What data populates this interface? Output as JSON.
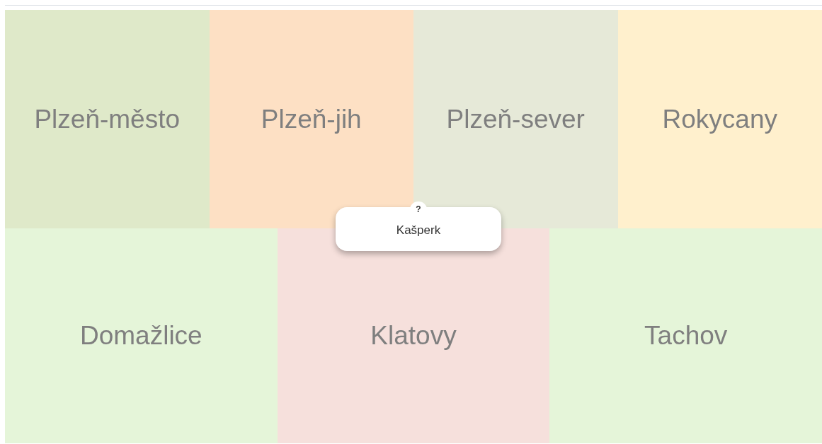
{
  "rows": [
    {
      "tiles": [
        {
          "label": "Plzeň-město",
          "color": "#dfe9c9"
        },
        {
          "label": "Plzeň-jih",
          "color": "#fde0c4"
        },
        {
          "label": "Plzeň-sever",
          "color": "#e6e9d8"
        },
        {
          "label": "Rokycany",
          "color": "#fff0cd"
        }
      ]
    },
    {
      "tiles": [
        {
          "label": "Domažlice",
          "color": "#e5f5d9"
        },
        {
          "label": "Klatovy",
          "color": "#f6e0dc"
        },
        {
          "label": "Tachov",
          "color": "#e5f5d9"
        }
      ]
    }
  ],
  "question_card": {
    "badge": "?",
    "text": "Kašperk"
  }
}
